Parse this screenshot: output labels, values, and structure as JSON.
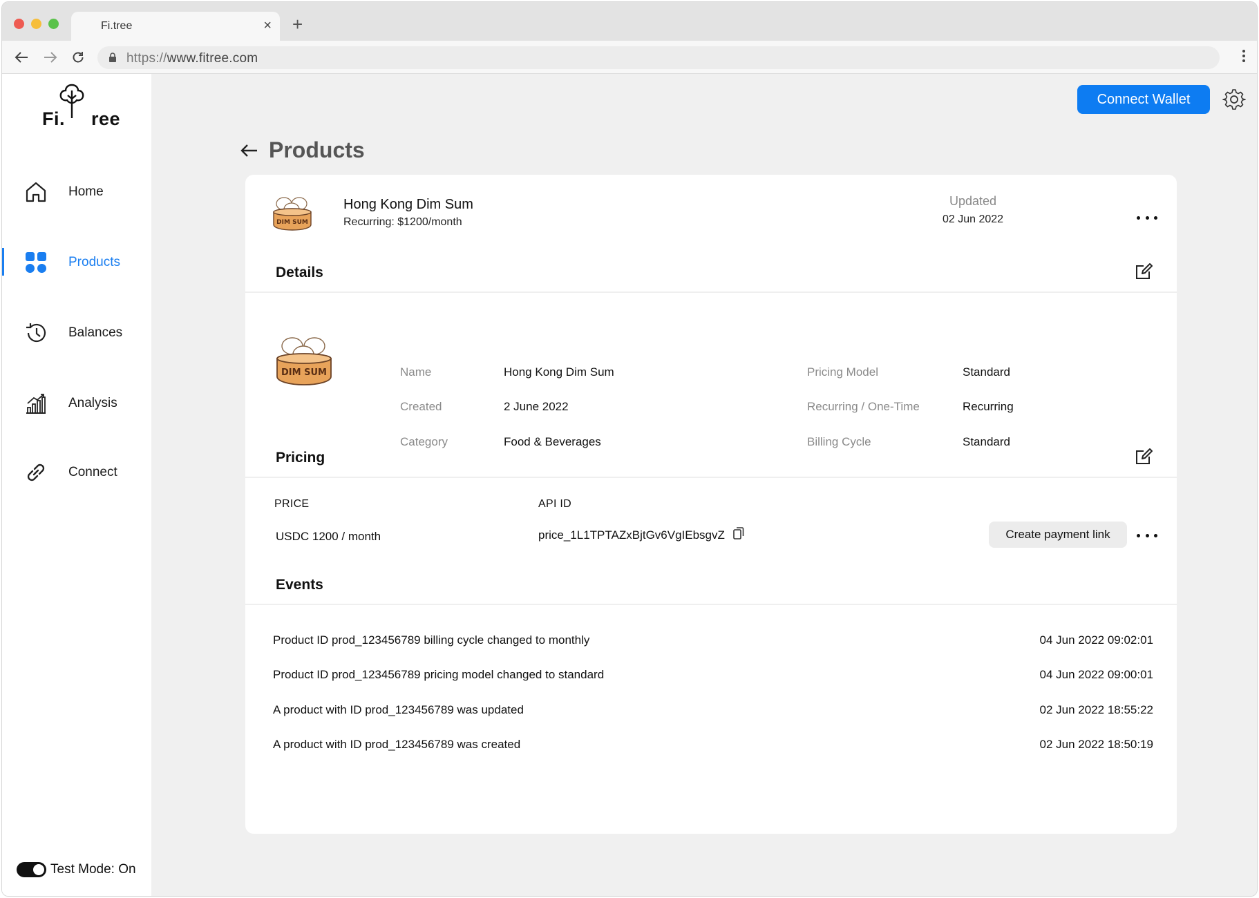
{
  "browser": {
    "tab_title": "Fi.tree",
    "tab_close": "×",
    "new_tab": "+",
    "url_scheme": "https://",
    "url_host": "www.fitree.com"
  },
  "logo": {
    "left": "Fi.",
    "right": "ree"
  },
  "sidebar": {
    "items": [
      {
        "label": "Home",
        "icon": "home-icon"
      },
      {
        "label": "Products",
        "icon": "grid-icon",
        "active": true
      },
      {
        "label": "Balances",
        "icon": "history-icon"
      },
      {
        "label": "Analysis",
        "icon": "bar-chart-icon"
      },
      {
        "label": "Connect",
        "icon": "link-icon"
      }
    ],
    "test_mode_label": "Test Mode: On",
    "test_mode_on": true
  },
  "header": {
    "connect_wallet_label": "Connect Wallet",
    "settings_icon": "gear-icon"
  },
  "page": {
    "title": "Products"
  },
  "product": {
    "name": "Hong Kong Dim Sum",
    "subtitle": "Recurring: $1200/month",
    "updated_label": "Updated",
    "updated_value": "02 Jun 2022",
    "image_text": "DIM SUM"
  },
  "details": {
    "title": "Details",
    "left": [
      {
        "label": "Name",
        "value": "Hong Kong Dim Sum"
      },
      {
        "label": "Created",
        "value": "2 June 2022"
      },
      {
        "label": "Category",
        "value": "Food & Beverages"
      }
    ],
    "right": [
      {
        "label": "Pricing Model",
        "value": "Standard"
      },
      {
        "label": "Recurring / One-Time",
        "value": "Recurring"
      },
      {
        "label": "Billing Cycle",
        "value": "Standard"
      }
    ]
  },
  "pricing": {
    "title": "Pricing",
    "col_price": "PRICE",
    "col_api": "API ID",
    "price": "USDC 1200 / month",
    "api_id": "price_1L1TPTAZxBjtGv6VgIEbsgvZ",
    "create_link_label": "Create payment link"
  },
  "events": {
    "title": "Events",
    "items": [
      {
        "text": "Product ID prod_123456789 billing cycle changed to monthly",
        "time": "04 Jun 2022 09:02:01"
      },
      {
        "text": "Product ID prod_123456789 pricing model changed to standard",
        "time": "04 Jun 2022 09:00:01"
      },
      {
        "text": "A product with ID prod_123456789 was updated",
        "time": "02 Jun 2022 18:55:22"
      },
      {
        "text": "A product with ID prod_123456789 was created",
        "time": "02 Jun 2022 18:50:19"
      }
    ]
  },
  "colors": {
    "accent": "#0d7cf2",
    "sidebar_bg": "#ffffff",
    "page_bg": "#f0f0f0",
    "card_bg": "#ffffff",
    "muted_text": "#8a8a8a"
  }
}
